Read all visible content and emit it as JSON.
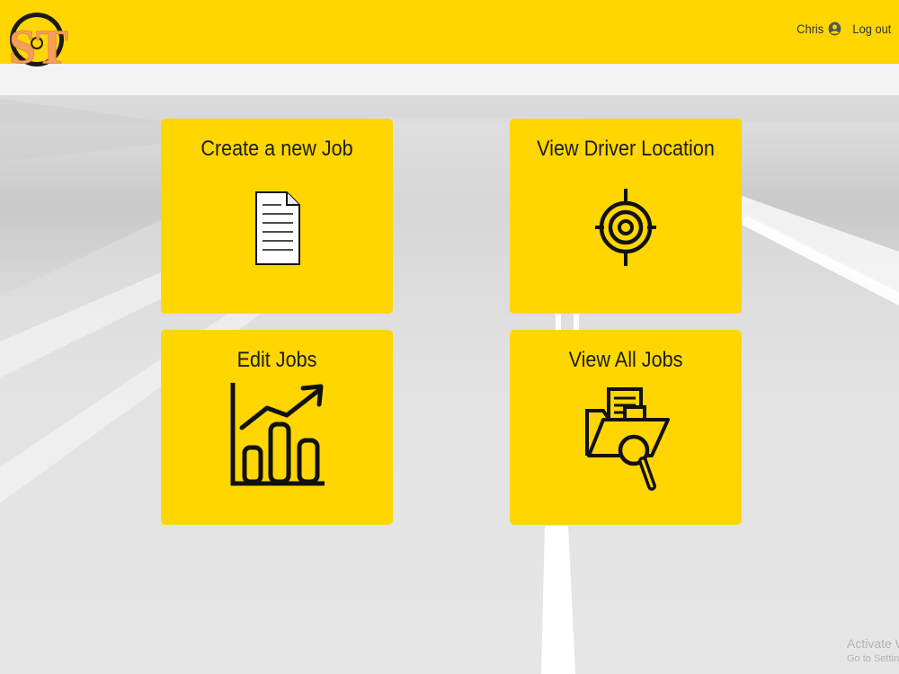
{
  "app": {
    "logo_text": "ST",
    "colors": {
      "brand_yellow": "#FFD600",
      "logo_orange": "#F4A05A",
      "logo_ring": "#1a1a1a"
    }
  },
  "header": {
    "user_name": "Chris",
    "user_icon": "account-circle-icon",
    "logout_label": "Log out"
  },
  "cards": [
    {
      "title": "Create a new Job",
      "icon": "document-icon"
    },
    {
      "title": "View Driver Location",
      "icon": "target-crosshair-icon"
    },
    {
      "title": "Edit Jobs",
      "icon": "bar-chart-trend-icon"
    },
    {
      "title": "View All Jobs",
      "icon": "folder-search-icon"
    }
  ],
  "watermark": {
    "line1": "Activate W",
    "line2": "Go to Settin"
  }
}
